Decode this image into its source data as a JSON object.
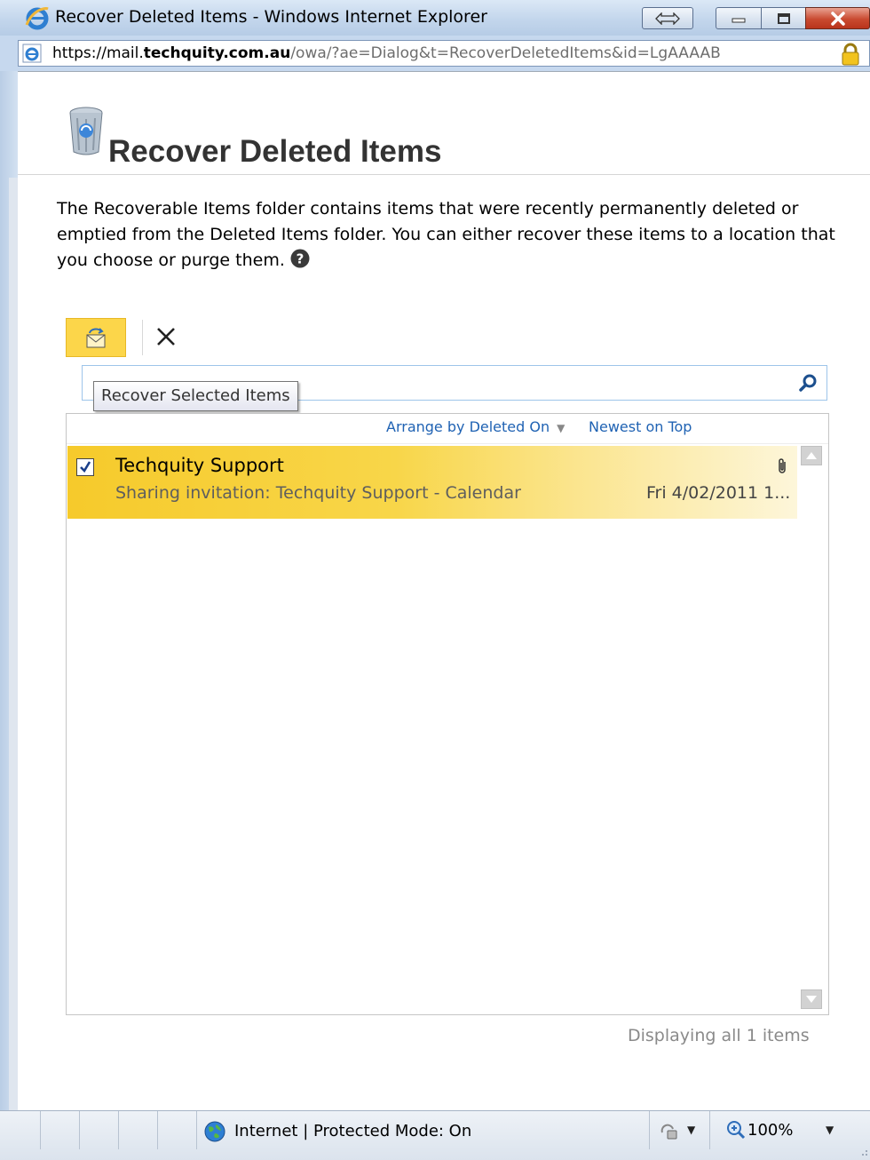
{
  "window": {
    "title": "Recover Deleted Items - Windows Internet Explorer",
    "url_scheme": "https://",
    "url_prefix": "mail.",
    "url_domain": "techquity.com.au",
    "url_path": "/owa/?ae=Dialog&t=RecoverDeletedItems&id=LgAAAAB"
  },
  "page": {
    "title": "Recover Deleted Items",
    "description": "The Recoverable Items folder contains items that were recently permanently deleted or emptied from the Deleted Items folder. You can either recover these items to a location that you choose or purge them."
  },
  "toolbar": {
    "recover_tooltip": "Recover Selected Items"
  },
  "search": {
    "placeholder": ""
  },
  "list": {
    "arrange_by": "Arrange by Deleted On",
    "sort_order": "Newest on Top",
    "items": [
      {
        "sender": "Techquity Support",
        "subject": "Sharing invitation: Techquity Support - Calendar",
        "date": "Fri 4/02/2011 1...",
        "checked": true,
        "has_attachment": true
      }
    ],
    "count_text": "Displaying all 1 items"
  },
  "statusbar": {
    "zone": "Internet | Protected Mode: On",
    "zoom": "100%"
  },
  "colors": {
    "selected_row": "#f6ca2b",
    "link": "#1f62b3",
    "toolbar_highlight": "#fcd64a"
  }
}
